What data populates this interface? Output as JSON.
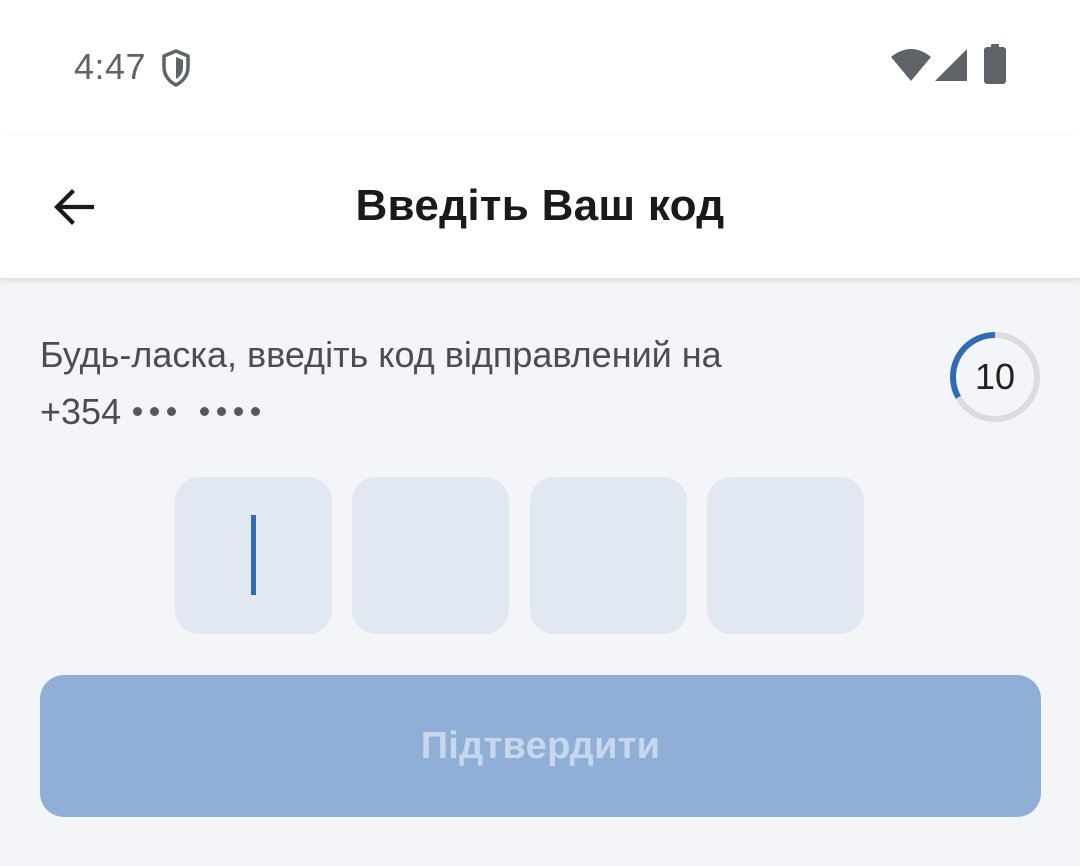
{
  "status_bar": {
    "time": "4:47",
    "icons": [
      "shield-icon",
      "wifi-icon",
      "signal-icon",
      "battery-icon"
    ]
  },
  "app_bar": {
    "title": "Введіть Ваш код",
    "back_icon": "arrow-left-icon"
  },
  "instruction": {
    "text": "Будь-ласка, введіть код відправлений на",
    "phone_prefix": "+354",
    "masked_groups": [
      3,
      4
    ]
  },
  "countdown": {
    "value": "10",
    "progress_fraction": 0.33,
    "ring_color": "#2f6cb5",
    "track_color": "#dcdcdc"
  },
  "code_input": {
    "digits": [
      "",
      "",
      "",
      ""
    ],
    "focused_index": 0
  },
  "confirm_button": {
    "label": "Підтвердити",
    "enabled": false
  },
  "colors": {
    "accent": "#2f6cb5",
    "button_disabled_bg": "#90afd7",
    "code_box_bg": "#e1e8f1",
    "background": "#f4f5f8"
  }
}
